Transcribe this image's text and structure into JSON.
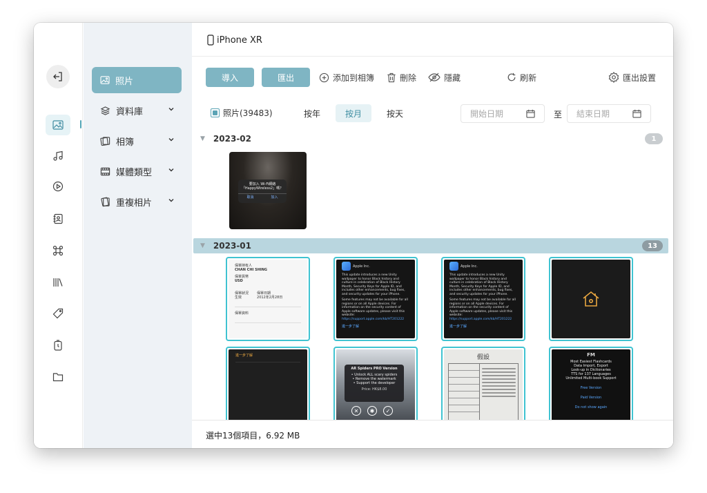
{
  "window": {
    "device_name": "iPhone XR"
  },
  "rail": {
    "icons": [
      "sign-out-icon",
      "photo-icon",
      "music-icon",
      "video-play-icon",
      "contacts-icon",
      "apps-icon",
      "books-icon",
      "tag-icon",
      "ringtone-icon",
      "folder-icon"
    ]
  },
  "nav": {
    "items": [
      {
        "label": "照片",
        "icon": "photo-icon",
        "active": true
      },
      {
        "label": "資料庫",
        "icon": "library-icon",
        "expandable": true
      },
      {
        "label": "相簿",
        "icon": "album-icon",
        "expandable": true
      },
      {
        "label": "媒體類型",
        "icon": "media-type-icon",
        "expandable": true
      },
      {
        "label": "重複相片",
        "icon": "duplicate-icon",
        "expandable": true
      }
    ]
  },
  "toolbar": {
    "import_label": "導入",
    "export_label": "匯出",
    "add_to_album_label": "添加到相簿",
    "delete_label": "刪除",
    "hide_label": "隱藏",
    "refresh_label": "刷新",
    "export_settings_label": "匯出設置"
  },
  "filter": {
    "photos_label": "照片(39483)",
    "by_year_label": "按年",
    "by_month_label": "按月",
    "by_day_label": "按天",
    "active_segment": "按月",
    "start_date_placeholder": "開始日期",
    "to_label": "至",
    "end_date_placeholder": "結束日期"
  },
  "groups": [
    {
      "label": "2023-02",
      "count": "1",
      "selected": false,
      "thumbs": [
        {
          "kind": "wifi-dialog",
          "title": "要加入 Wi-Fi網絡",
          "subtitle": "「HappyWireless2」嗎？",
          "cancel": "取消",
          "join": "加入"
        }
      ]
    },
    {
      "label": "2023-01",
      "count": "13",
      "selected": true,
      "thumbs": [
        {
          "kind": "insurance-doc",
          "line1": "保單持有人",
          "line2": "CHAN CHI SHING",
          "line3": "保單貨幣",
          "line4": "USD",
          "line5": "保單狀況",
          "line6": "生效",
          "line7": "保單日期",
          "line8": "2012年2月28日",
          "line9": "保單資料"
        },
        {
          "kind": "update-text",
          "header": "Apple Inc.",
          "body": "This update introduces a new Unity wallpaper to honor Black history and culture in celebration of Black History Month, Security Keys for Apple ID, and includes other enhancements, bug fixes, and security updates for your iPhone.",
          "body2": "Some features may not be available for all regions or on all Apple devices. For information on the security content of Apple software updates, please visit this website:",
          "link": "https://support.apple.com/kb/HT201222",
          "more": "進一步了解"
        },
        {
          "kind": "update-text",
          "header": "Apple Inc.",
          "body": "This update introduces a new Unity wallpaper to honor Black history and culture in celebration of Black History Month, Security Keys for Apple ID, and includes other enhancements, bug fixes, and security updates for your iPhone.",
          "body2": "Some features may not be available for all regions or on all Apple devices. For information on the security content of Apple software updates, please visit this website:",
          "link": "https://support.apple.com/kb/HT201222",
          "more": "進一步了解"
        },
        {
          "kind": "home-icon"
        },
        {
          "kind": "dark-more",
          "more": "進一步了解"
        },
        {
          "kind": "spiders-pro",
          "title": "AR Spiders PRO Version",
          "f1": "• Unlock ALL scary spiders",
          "f2": "• Remove the watermark",
          "f3": "• Support the developer",
          "price": "Price: HK$8.00"
        },
        {
          "kind": "handwritten-table",
          "title": "假設"
        },
        {
          "kind": "flashcards",
          "f1": "Most Easiest Flashcards",
          "f2": "Data Import, Export",
          "f3": "Look-up in Dictionaries",
          "f4": "TTS for 137 Languages",
          "f5": "Unlimited Multi-book Support",
          "b1": "Free Version",
          "b2": "Paid Version",
          "b3": "Do not show again"
        }
      ]
    }
  ],
  "status": {
    "text": "選中13個項目，6.92 MB"
  },
  "colors": {
    "accent": "#7fb5c3",
    "selection_border": "#3fc3d1",
    "nav_bg": "#eef2f6",
    "group_selected_bg": "#b9d6df"
  }
}
